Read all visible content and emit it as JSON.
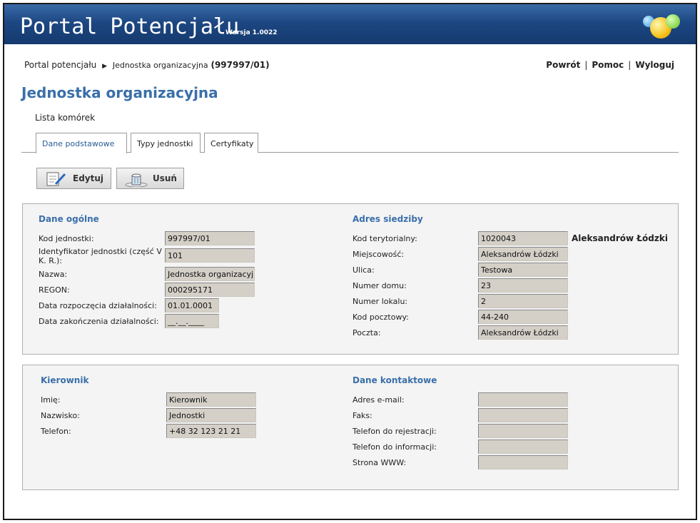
{
  "header": {
    "title": "Portal Potencjału",
    "version": "Wersja 1.0022"
  },
  "breadcrumb": {
    "root": "Portal potencjału",
    "current": "Jednostka organizacyjna",
    "number": "(997997/01)"
  },
  "toplinks": {
    "back": "Powrót",
    "help": "Pomoc",
    "logout": "Wyloguj"
  },
  "page_title": "Jednostka organizacyjna",
  "list_cells": "Lista komórek",
  "tabs": [
    {
      "label": "Dane podstawowe",
      "active": true
    },
    {
      "label": "Typy jednostki",
      "active": false
    },
    {
      "label": "Certyfikaty",
      "active": false
    }
  ],
  "toolbar": {
    "edit_label": "Edytuj",
    "delete_label": "Usuń"
  },
  "general": {
    "heading": "Dane ogólne",
    "rows": [
      {
        "label": "Kod jednostki:",
        "value": "997997/01"
      },
      {
        "label": "Identyfikator jednostki (część V K. R.):",
        "value": "101"
      },
      {
        "label": "Nazwa:",
        "value": "Jednostka organizacyj"
      },
      {
        "label": "REGON:",
        "value": "000295171"
      },
      {
        "label": "Data rozpoczęcia działalności:",
        "value": "01.01.0001"
      },
      {
        "label": "Data zakończenia działalności:",
        "value": "__.__.____"
      }
    ]
  },
  "address": {
    "heading": "Adres siedziby",
    "territory_name": "Aleksandrów Łódzki",
    "rows": [
      {
        "label": "Kod terytorialny:",
        "value": "1020043"
      },
      {
        "label": "Miejscowość:",
        "value": "Aleksandrów Łódzki"
      },
      {
        "label": "Ulica:",
        "value": "Testowa"
      },
      {
        "label": "Numer domu:",
        "value": "23"
      },
      {
        "label": "Numer lokalu:",
        "value": "2"
      },
      {
        "label": "Kod pocztowy:",
        "value": "44-240"
      },
      {
        "label": "Poczta:",
        "value": "Aleksandrów Łódzki"
      }
    ]
  },
  "manager": {
    "heading": "Kierownik",
    "rows": [
      {
        "label": "Imię:",
        "value": "Kierownik"
      },
      {
        "label": "Nazwisko:",
        "value": "Jednostki"
      },
      {
        "label": "Telefon:",
        "value": "+48 32 123 21 21"
      }
    ]
  },
  "contact": {
    "heading": "Dane kontaktowe",
    "rows": [
      {
        "label": "Adres e-mail:",
        "value": ""
      },
      {
        "label": "Faks:",
        "value": ""
      },
      {
        "label": "Telefon do rejestracji:",
        "value": ""
      },
      {
        "label": "Telefon do informacji:",
        "value": ""
      },
      {
        "label": "Strona WWW:",
        "value": ""
      }
    ]
  },
  "colors": {
    "header_blue": "#1d4782",
    "accent_blue": "#3a6fa9",
    "field_bg": "#d4d0c8",
    "panel_bg": "#f4f4f4"
  },
  "icons": {
    "edit": "edit-document-icon",
    "delete": "trash-icon",
    "breadcrumb_separator": "triangle-right-icon"
  }
}
